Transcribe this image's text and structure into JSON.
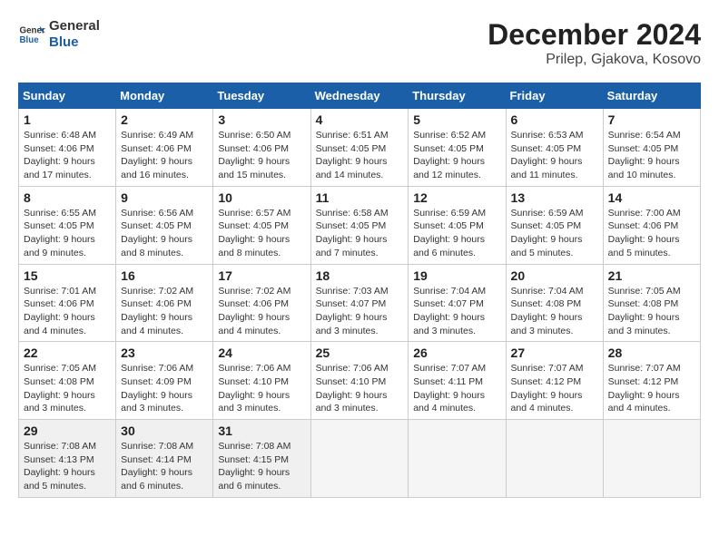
{
  "header": {
    "logo_general": "General",
    "logo_blue": "Blue",
    "month_title": "December 2024",
    "location": "Prilep, Gjakova, Kosovo"
  },
  "days_of_week": [
    "Sunday",
    "Monday",
    "Tuesday",
    "Wednesday",
    "Thursday",
    "Friday",
    "Saturday"
  ],
  "weeks": [
    [
      {
        "day": "1",
        "sunrise": "6:48 AM",
        "sunset": "4:06 PM",
        "daylight": "9 hours and 17 minutes."
      },
      {
        "day": "2",
        "sunrise": "6:49 AM",
        "sunset": "4:06 PM",
        "daylight": "9 hours and 16 minutes."
      },
      {
        "day": "3",
        "sunrise": "6:50 AM",
        "sunset": "4:06 PM",
        "daylight": "9 hours and 15 minutes."
      },
      {
        "day": "4",
        "sunrise": "6:51 AM",
        "sunset": "4:05 PM",
        "daylight": "9 hours and 14 minutes."
      },
      {
        "day": "5",
        "sunrise": "6:52 AM",
        "sunset": "4:05 PM",
        "daylight": "9 hours and 12 minutes."
      },
      {
        "day": "6",
        "sunrise": "6:53 AM",
        "sunset": "4:05 PM",
        "daylight": "9 hours and 11 minutes."
      },
      {
        "day": "7",
        "sunrise": "6:54 AM",
        "sunset": "4:05 PM",
        "daylight": "9 hours and 10 minutes."
      }
    ],
    [
      {
        "day": "8",
        "sunrise": "6:55 AM",
        "sunset": "4:05 PM",
        "daylight": "9 hours and 9 minutes."
      },
      {
        "day": "9",
        "sunrise": "6:56 AM",
        "sunset": "4:05 PM",
        "daylight": "9 hours and 8 minutes."
      },
      {
        "day": "10",
        "sunrise": "6:57 AM",
        "sunset": "4:05 PM",
        "daylight": "9 hours and 8 minutes."
      },
      {
        "day": "11",
        "sunrise": "6:58 AM",
        "sunset": "4:05 PM",
        "daylight": "9 hours and 7 minutes."
      },
      {
        "day": "12",
        "sunrise": "6:59 AM",
        "sunset": "4:05 PM",
        "daylight": "9 hours and 6 minutes."
      },
      {
        "day": "13",
        "sunrise": "6:59 AM",
        "sunset": "4:05 PM",
        "daylight": "9 hours and 5 minutes."
      },
      {
        "day": "14",
        "sunrise": "7:00 AM",
        "sunset": "4:06 PM",
        "daylight": "9 hours and 5 minutes."
      }
    ],
    [
      {
        "day": "15",
        "sunrise": "7:01 AM",
        "sunset": "4:06 PM",
        "daylight": "9 hours and 4 minutes."
      },
      {
        "day": "16",
        "sunrise": "7:02 AM",
        "sunset": "4:06 PM",
        "daylight": "9 hours and 4 minutes."
      },
      {
        "day": "17",
        "sunrise": "7:02 AM",
        "sunset": "4:06 PM",
        "daylight": "9 hours and 4 minutes."
      },
      {
        "day": "18",
        "sunrise": "7:03 AM",
        "sunset": "4:07 PM",
        "daylight": "9 hours and 3 minutes."
      },
      {
        "day": "19",
        "sunrise": "7:04 AM",
        "sunset": "4:07 PM",
        "daylight": "9 hours and 3 minutes."
      },
      {
        "day": "20",
        "sunrise": "7:04 AM",
        "sunset": "4:08 PM",
        "daylight": "9 hours and 3 minutes."
      },
      {
        "day": "21",
        "sunrise": "7:05 AM",
        "sunset": "4:08 PM",
        "daylight": "9 hours and 3 minutes."
      }
    ],
    [
      {
        "day": "22",
        "sunrise": "7:05 AM",
        "sunset": "4:08 PM",
        "daylight": "9 hours and 3 minutes."
      },
      {
        "day": "23",
        "sunrise": "7:06 AM",
        "sunset": "4:09 PM",
        "daylight": "9 hours and 3 minutes."
      },
      {
        "day": "24",
        "sunrise": "7:06 AM",
        "sunset": "4:10 PM",
        "daylight": "9 hours and 3 minutes."
      },
      {
        "day": "25",
        "sunrise": "7:06 AM",
        "sunset": "4:10 PM",
        "daylight": "9 hours and 3 minutes."
      },
      {
        "day": "26",
        "sunrise": "7:07 AM",
        "sunset": "4:11 PM",
        "daylight": "9 hours and 4 minutes."
      },
      {
        "day": "27",
        "sunrise": "7:07 AM",
        "sunset": "4:12 PM",
        "daylight": "9 hours and 4 minutes."
      },
      {
        "day": "28",
        "sunrise": "7:07 AM",
        "sunset": "4:12 PM",
        "daylight": "9 hours and 4 minutes."
      }
    ],
    [
      {
        "day": "29",
        "sunrise": "7:08 AM",
        "sunset": "4:13 PM",
        "daylight": "9 hours and 5 minutes."
      },
      {
        "day": "30",
        "sunrise": "7:08 AM",
        "sunset": "4:14 PM",
        "daylight": "9 hours and 6 minutes."
      },
      {
        "day": "31",
        "sunrise": "7:08 AM",
        "sunset": "4:15 PM",
        "daylight": "9 hours and 6 minutes."
      },
      null,
      null,
      null,
      null
    ]
  ]
}
